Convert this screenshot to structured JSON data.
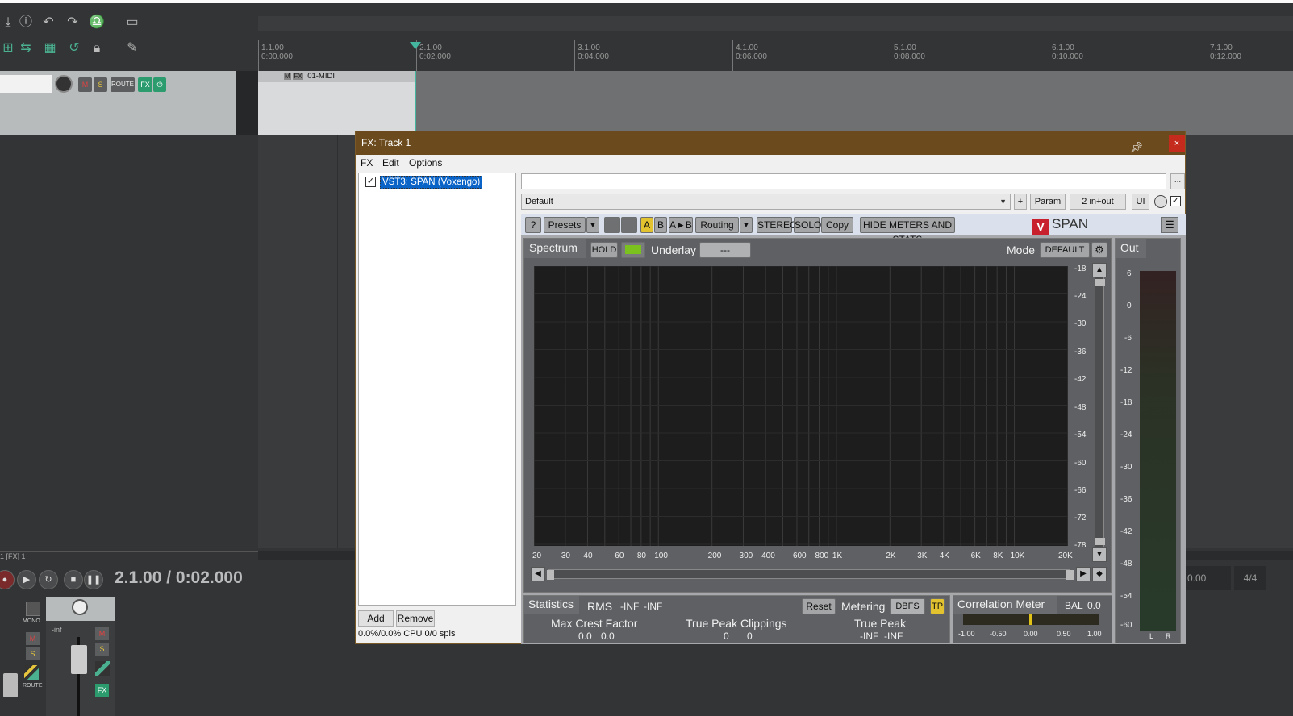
{
  "ruler": {
    "marks": [
      {
        "bar": "1.1.00",
        "time": "0:00.000"
      },
      {
        "bar": "2.1.00",
        "time": "0:02.000"
      },
      {
        "bar": "3.1.00",
        "time": "0:04.000"
      },
      {
        "bar": "4.1.00",
        "time": "0:06.000"
      },
      {
        "bar": "5.1.00",
        "time": "0:08.000"
      },
      {
        "bar": "6.1.00",
        "time": "0:10.000"
      },
      {
        "bar": "7.1.00",
        "time": "0:12.000"
      }
    ]
  },
  "track": {
    "mute": "M",
    "solo": "S",
    "route": "ROUTE",
    "fx": "FX",
    "item_name": "01-MIDI",
    "item_flags": [
      "M",
      "FX"
    ]
  },
  "mixer": {
    "label": "1 [FX] 1",
    "master_mono": "MONO",
    "master_m": "M",
    "master_s": "S",
    "master_route": "ROUTE",
    "strip_level": "-inf",
    "strip_m": "M",
    "strip_s": "S",
    "strip_fx": "FX"
  },
  "transport": {
    "time": "2.1.00 / 0:02.000",
    "right_time": "0.00",
    "time_signature": "4/4"
  },
  "fx_window": {
    "title": "FX: Track 1",
    "close": "×",
    "menu": [
      "FX",
      "Edit",
      "Options"
    ],
    "plugins": [
      {
        "name": "VST3: SPAN (Voxengo)",
        "enabled": true
      }
    ],
    "add_label": "Add",
    "remove_label": "Remove",
    "cpu": "0.0%/0.0% CPU 0/0 spls",
    "preset_more": "...",
    "preset": "Default",
    "plus": "+",
    "param": "Param",
    "io": "2 in+out",
    "ui": "UI"
  },
  "span": {
    "toolbar": {
      "help": "?",
      "presets": "Presets",
      "a": "A",
      "b": "B",
      "a_to_b": "A►B",
      "routing": "Routing",
      "stereo": "STEREO",
      "solo": "SOLO",
      "copy": "Copy",
      "hide_meters": "HIDE METERS AND STATS",
      "logo": "SPAN"
    },
    "spectrum": {
      "tab": "Spectrum",
      "hold": "HOLD",
      "underlay_label": "Underlay",
      "underlay_value": "---",
      "mode_label": "Mode",
      "mode_value": "DEFAULT",
      "db_ticks": [
        "-18",
        "-24",
        "-30",
        "-36",
        "-42",
        "-48",
        "-54",
        "-60",
        "-66",
        "-72",
        "-78"
      ],
      "hz_ticks": [
        "20",
        "30",
        "40",
        "60",
        "80",
        "100",
        "200",
        "300",
        "400",
        "600",
        "800",
        "1K",
        "2K",
        "3K",
        "4K",
        "6K",
        "8K",
        "10K",
        "20K"
      ]
    },
    "out": {
      "tab": "Out",
      "ticks": [
        "6",
        "0",
        "-6",
        "-12",
        "-18",
        "-24",
        "-30",
        "-36",
        "-42",
        "-48",
        "-54",
        "-60"
      ],
      "channels": [
        "L",
        "R"
      ]
    },
    "stats": {
      "tab": "Statistics",
      "rms_label": "RMS",
      "rms_values": [
        "-INF",
        "-INF"
      ],
      "reset": "Reset",
      "metering_label": "Metering",
      "metering_value": "DBFS",
      "tp": "TP",
      "max_crest_label": "Max Crest Factor",
      "max_crest_values": [
        "0.0",
        "0.0"
      ],
      "tp_clip_label": "True Peak Clippings",
      "tp_clip_values": [
        "0",
        "0"
      ],
      "true_peak_label": "True Peak",
      "true_peak_values": [
        "-INF",
        "-INF"
      ]
    },
    "correlation": {
      "tab": "Correlation Meter",
      "bal_label": "BAL",
      "bal_value": "0.0",
      "ticks": [
        "-1.00",
        "-0.50",
        "0.00",
        "0.50",
        "1.00"
      ]
    }
  },
  "colors": {
    "fx_title_bg": "#6b4b1d",
    "span_panel": "#5e6063",
    "spectrum_bg": "#1d1d1d",
    "selection": "#0a64c8",
    "playhead": "#44b59e",
    "tp_button": "#e2c22e"
  }
}
